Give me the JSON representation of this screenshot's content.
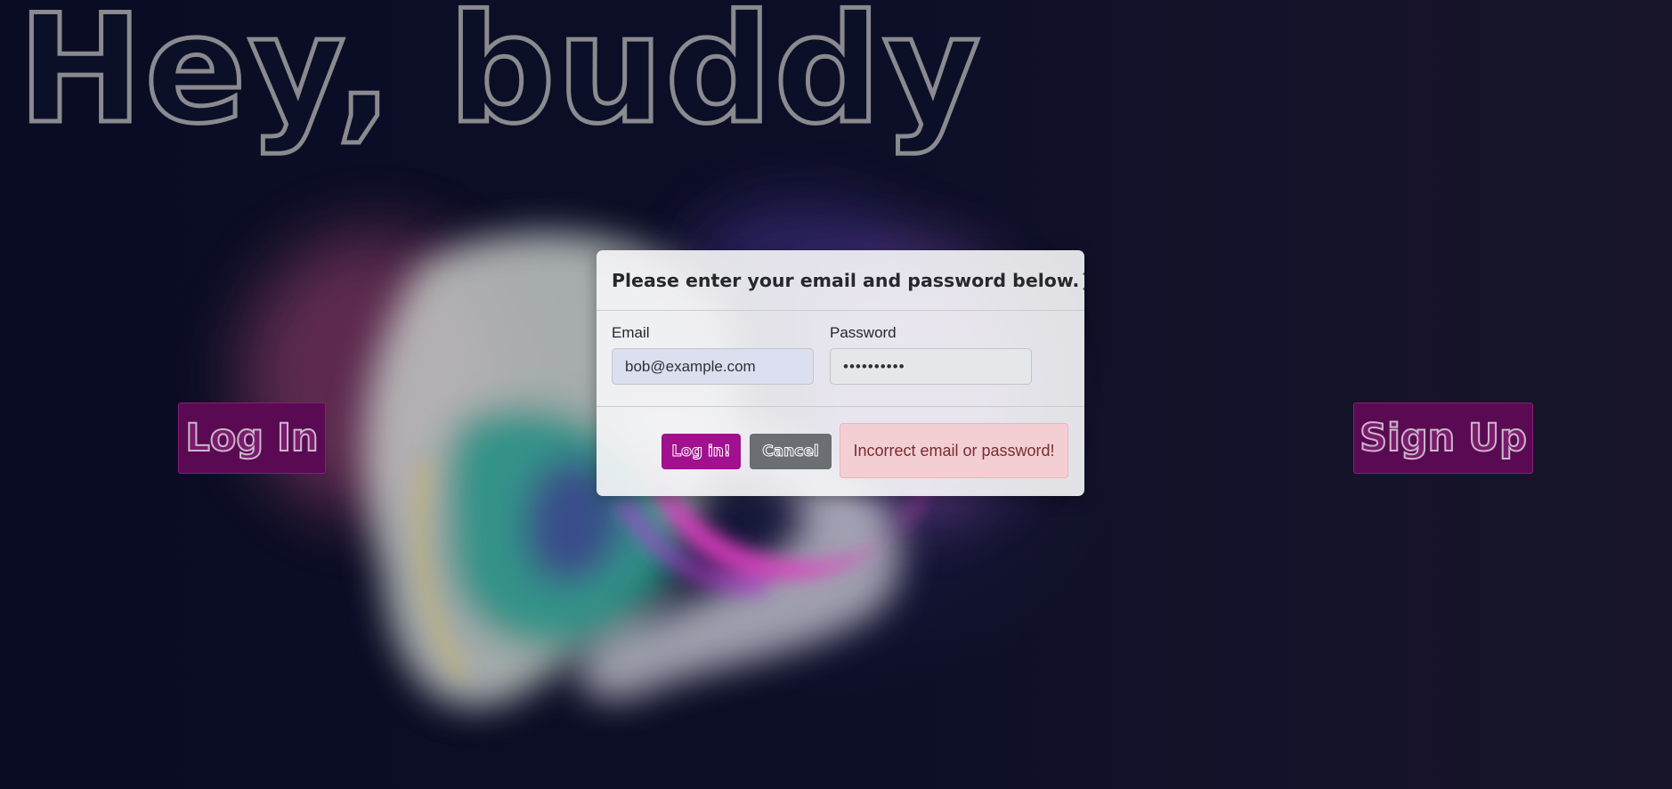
{
  "hero": {
    "title": "Hey, buddy"
  },
  "page_buttons": {
    "login_label": "Log In",
    "signup_label": "Sign Up"
  },
  "modal": {
    "title": "Please enter your email and password below.",
    "close_icon": "close-icon",
    "email": {
      "label": "Email",
      "value": "bob@example.com"
    },
    "password": {
      "label": "Password",
      "value": "••••••••••"
    },
    "login_button_label": "Log in!",
    "cancel_button_label": "Cancel",
    "error_message": "Incorrect email or password!"
  },
  "colors": {
    "background": "#0b0d22",
    "accent": "#a0108f",
    "page_button": "#5a0a52",
    "cancel": "#6b6e73",
    "error_bg": "#f3cfd3",
    "error_text": "#7a2a33"
  }
}
